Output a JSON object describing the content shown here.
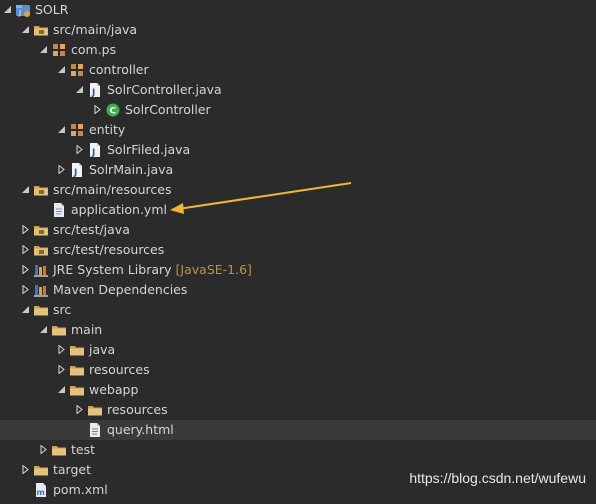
{
  "tree": [
    {
      "label": "SOLR",
      "depth": 0,
      "state": "expanded",
      "icon": "project-icon"
    },
    {
      "label": "src/main/java",
      "depth": 1,
      "state": "expanded",
      "icon": "source-folder-icon"
    },
    {
      "label": "com.ps",
      "depth": 2,
      "state": "expanded",
      "icon": "package-icon"
    },
    {
      "label": "controller",
      "depth": 3,
      "state": "expanded",
      "icon": "package-icon"
    },
    {
      "label": "SolrController.java",
      "depth": 4,
      "state": "expanded",
      "icon": "java-file-icon"
    },
    {
      "label": "SolrController",
      "depth": 5,
      "state": "collapsed",
      "icon": "class-icon"
    },
    {
      "label": "entity",
      "depth": 3,
      "state": "expanded",
      "icon": "package-icon"
    },
    {
      "label": "SolrFiled.java",
      "depth": 4,
      "state": "collapsed",
      "icon": "java-file-icon"
    },
    {
      "label": "SolrMain.java",
      "depth": 3,
      "state": "collapsed",
      "icon": "java-file-icon"
    },
    {
      "label": "src/main/resources",
      "depth": 1,
      "state": "expanded",
      "icon": "source-folder-icon"
    },
    {
      "label": "application.yml",
      "depth": 2,
      "state": "none",
      "icon": "text-file-icon"
    },
    {
      "label": "src/test/java",
      "depth": 1,
      "state": "collapsed",
      "icon": "source-folder-icon"
    },
    {
      "label": "src/test/resources",
      "depth": 1,
      "state": "collapsed",
      "icon": "source-folder-icon"
    },
    {
      "label": "JRE System Library",
      "decor": "[JavaSE-1.6]",
      "depth": 1,
      "state": "collapsed",
      "icon": "library-icon"
    },
    {
      "label": "Maven Dependencies",
      "depth": 1,
      "state": "collapsed",
      "icon": "library-icon"
    },
    {
      "label": "src",
      "depth": 1,
      "state": "expanded",
      "icon": "folder-icon"
    },
    {
      "label": "main",
      "depth": 2,
      "state": "expanded",
      "icon": "folder-icon"
    },
    {
      "label": "java",
      "depth": 3,
      "state": "collapsed",
      "icon": "folder-icon"
    },
    {
      "label": "resources",
      "depth": 3,
      "state": "collapsed",
      "icon": "folder-icon"
    },
    {
      "label": "webapp",
      "depth": 3,
      "state": "expanded",
      "icon": "folder-icon"
    },
    {
      "label": "resources",
      "depth": 4,
      "state": "collapsed",
      "icon": "folder-icon"
    },
    {
      "label": "query.html",
      "depth": 4,
      "state": "none",
      "icon": "html-file-icon",
      "selected": true
    },
    {
      "label": "test",
      "depth": 2,
      "state": "collapsed",
      "icon": "folder-icon"
    },
    {
      "label": "target",
      "depth": 1,
      "state": "collapsed",
      "icon": "folder-icon"
    },
    {
      "label": "pom.xml",
      "depth": 1,
      "state": "none",
      "icon": "xml-file-icon"
    }
  ],
  "annotation": {
    "color": "#f2b632",
    "target": "application.yml"
  },
  "watermark": "https://blog.csdn.net/wufewu"
}
